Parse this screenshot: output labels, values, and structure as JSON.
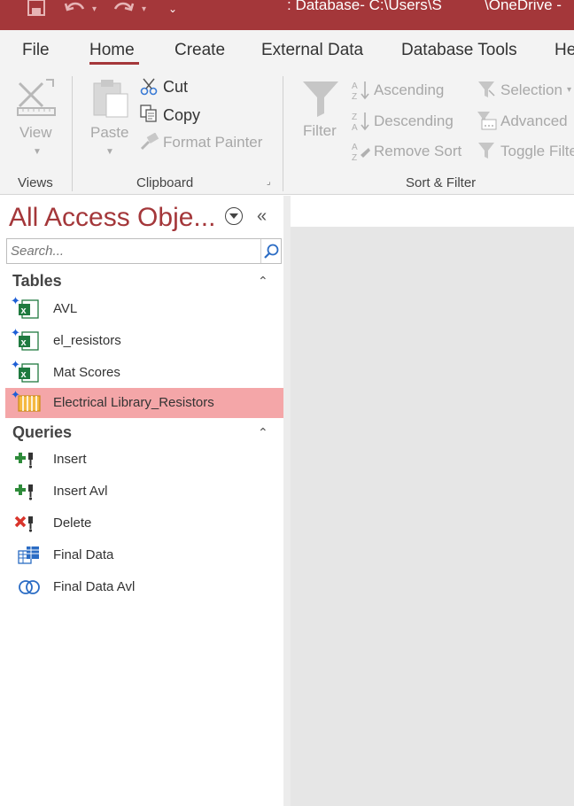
{
  "window": {
    "title": ": Database- C:\\Users\\S",
    "title_right": "\\OneDrive -"
  },
  "tabs": [
    {
      "label": "File"
    },
    {
      "label": "Home"
    },
    {
      "label": "Create"
    },
    {
      "label": "External Data"
    },
    {
      "label": "Database Tools"
    },
    {
      "label": "He"
    }
  ],
  "ribbon": {
    "views": {
      "view_label": "View",
      "group_label": "Views"
    },
    "clipboard": {
      "paste_label": "Paste",
      "cut_label": "Cut",
      "copy_label": "Copy",
      "format_painter_label": "Format Painter",
      "group_label": "Clipboard"
    },
    "sort_filter": {
      "filter_label": "Filter",
      "ascending_label": "Ascending",
      "descending_label": "Descending",
      "remove_sort_label": "Remove Sort",
      "selection_label": "Selection",
      "advanced_label": "Advanced",
      "toggle_filter_label": "Toggle Filte",
      "group_label": "Sort & Filter"
    }
  },
  "nav": {
    "title": "All Access Obje...",
    "search_placeholder": "Search...",
    "sections": [
      {
        "label": "Tables",
        "items": [
          {
            "label": "AVL"
          },
          {
            "label": "el_resistors"
          },
          {
            "label": "Mat Scores"
          },
          {
            "label": "Electrical Library_Resistors"
          }
        ]
      },
      {
        "label": "Queries",
        "items": [
          {
            "label": "Insert"
          },
          {
            "label": "Insert Avl"
          },
          {
            "label": "Delete"
          },
          {
            "label": "Final Data"
          },
          {
            "label": "Final Data Avl"
          }
        ]
      }
    ]
  },
  "colors": {
    "accent": "#a4373a",
    "selected_row": "#f4a6a8",
    "ribbon_bg": "#f3f3f3",
    "workspace_bg": "#e6e6e6"
  }
}
